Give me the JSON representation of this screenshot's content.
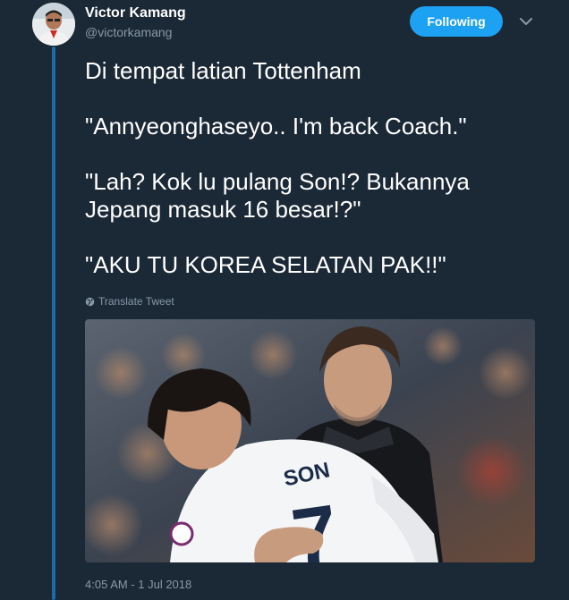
{
  "author": {
    "name": "Victor Kamang",
    "handle": "@victorkamang"
  },
  "follow_button": {
    "label": "Following"
  },
  "tweet": {
    "paragraphs": [
      "Di tempat latian Tottenham",
      "\"Annyeonghaseyo.. I'm back Coach.\"",
      "\"Lah? Kok lu pulang Son!? Bukannya Jepang masuk 16 besar!?\"",
      "\"AKU TU KOREA SELATAN PAK!!\""
    ],
    "translate_label": "Translate Tweet",
    "image": {
      "jersey_name": "SON",
      "jersey_number": "7"
    },
    "timestamp": "4:05 AM - 1 Jul 2018"
  },
  "colors": {
    "background": "#1b2836",
    "accent": "#1da1f2",
    "thread_line": "#1c6aa6",
    "secondary_text": "#8899a6"
  },
  "icons": {
    "more_menu": "chevron-down-icon",
    "translate": "globe-icon"
  }
}
